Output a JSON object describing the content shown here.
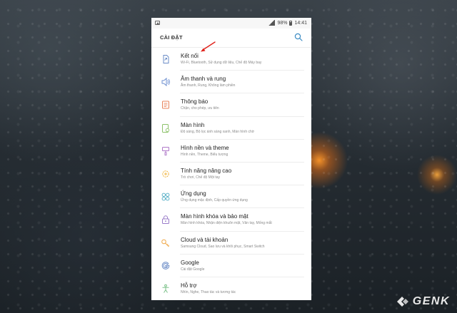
{
  "status_bar": {
    "battery": "98%",
    "time": "14:41"
  },
  "header": {
    "title": "CÀI ĐẶT"
  },
  "settings": [
    {
      "label": "Kết nối",
      "subtitle": "Wi-Fi, Bluetooth, Sử dụng dữ liệu, Chế độ Máy bay",
      "icon": "connections-icon",
      "color": "#6b8cc7"
    },
    {
      "label": "Âm thanh và rung",
      "subtitle": "Âm thanh, Rung, Không làm phiền",
      "icon": "speaker-icon",
      "color": "#6d8fd0"
    },
    {
      "label": "Thông báo",
      "subtitle": "Chặn, cho phép, ưu tiên",
      "icon": "notifications-icon",
      "color": "#e8835b"
    },
    {
      "label": "Màn hình",
      "subtitle": "Độ sáng, Bộ lọc ánh sáng xanh, Màn hình chờ",
      "icon": "display-icon",
      "color": "#8dc26a"
    },
    {
      "label": "Hình nền và theme",
      "subtitle": "Hình nền, Theme, Biểu tượng",
      "icon": "paintbrush-icon",
      "color": "#b07ac9"
    },
    {
      "label": "Tính năng nâng cao",
      "subtitle": "Trò chơi, Chế độ Một tay",
      "icon": "gear-plus-icon",
      "color": "#f0b33a"
    },
    {
      "label": "Ứng dụng",
      "subtitle": "Ứng dụng mặc định, Cấp quyền ứng dụng",
      "icon": "apps-grid-icon",
      "color": "#5fb3c9"
    },
    {
      "label": "Màn hình khóa và bảo mật",
      "subtitle": "Màn hình khóa, Nhận diện khuôn mặt, Vân tay, Mống mắt",
      "icon": "lock-icon",
      "color": "#9a7cc9"
    },
    {
      "label": "Cloud và tài khoản",
      "subtitle": "Samsung Cloud, Sao lưu và khôi phục, Smart Switch",
      "icon": "key-icon",
      "color": "#f0a94a"
    },
    {
      "label": "Google",
      "subtitle": "Cài đặt Google",
      "icon": "google-icon",
      "color": "#6b8cc7"
    },
    {
      "label": "Hỗ trợ",
      "subtitle": "Nhìn, Nghe, Thao tác và tương tác",
      "icon": "accessibility-icon",
      "color": "#7dc28a"
    }
  ],
  "watermark": {
    "brand": "GENK"
  },
  "colors": {
    "annotation_arrow": "#e0221b",
    "search_icon": "#3c8cc4"
  }
}
